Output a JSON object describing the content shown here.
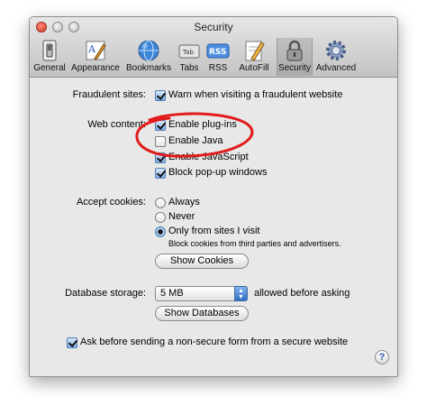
{
  "window": {
    "title": "Security"
  },
  "toolbar": {
    "items": [
      {
        "label": "General",
        "icon": "general-switch-icon"
      },
      {
        "label": "Appearance",
        "icon": "appearance-pen-icon"
      },
      {
        "label": "Bookmarks",
        "icon": "bookmarks-globe-icon"
      },
      {
        "label": "Tabs",
        "icon": "tabs-icon"
      },
      {
        "label": "RSS",
        "icon": "rss-icon"
      },
      {
        "label": "AutoFill",
        "icon": "autofill-pencil-icon"
      },
      {
        "label": "Security",
        "icon": "security-lock-icon",
        "active": true
      },
      {
        "label": "Advanced",
        "icon": "advanced-gear-icon"
      }
    ],
    "tabs_icon_text": "Tab",
    "rss_icon_text": "RSS"
  },
  "fraud": {
    "label": "Fraudulent sites:",
    "warn_label": "Warn when visiting a fraudulent website",
    "warn_checked": true
  },
  "web_content": {
    "label": "Web content:",
    "plugins_label": "Enable plug-ins",
    "plugins_checked": true,
    "java_label": "Enable Java",
    "java_checked": false,
    "javascript_label": "Enable JavaScript",
    "javascript_checked": true,
    "popups_label": "Block pop-up windows",
    "popups_checked": true
  },
  "cookies": {
    "label": "Accept cookies:",
    "always_label": "Always",
    "never_label": "Never",
    "only_visited_label": "Only from sites I visit",
    "hint": "Block cookies from third parties and advertisers.",
    "selected": "Only from sites I visit",
    "show_button": "Show Cookies"
  },
  "database": {
    "label": "Database storage:",
    "value": "5 MB",
    "suffix": "allowed before asking",
    "show_button": "Show Databases"
  },
  "secure_form": {
    "label": "Ask before sending a non-secure form from a secure website",
    "checked": true
  },
  "help": {
    "symbol": "?"
  },
  "colors": {
    "annotation": "#e11b1b",
    "accent": "#4f7fb3"
  }
}
